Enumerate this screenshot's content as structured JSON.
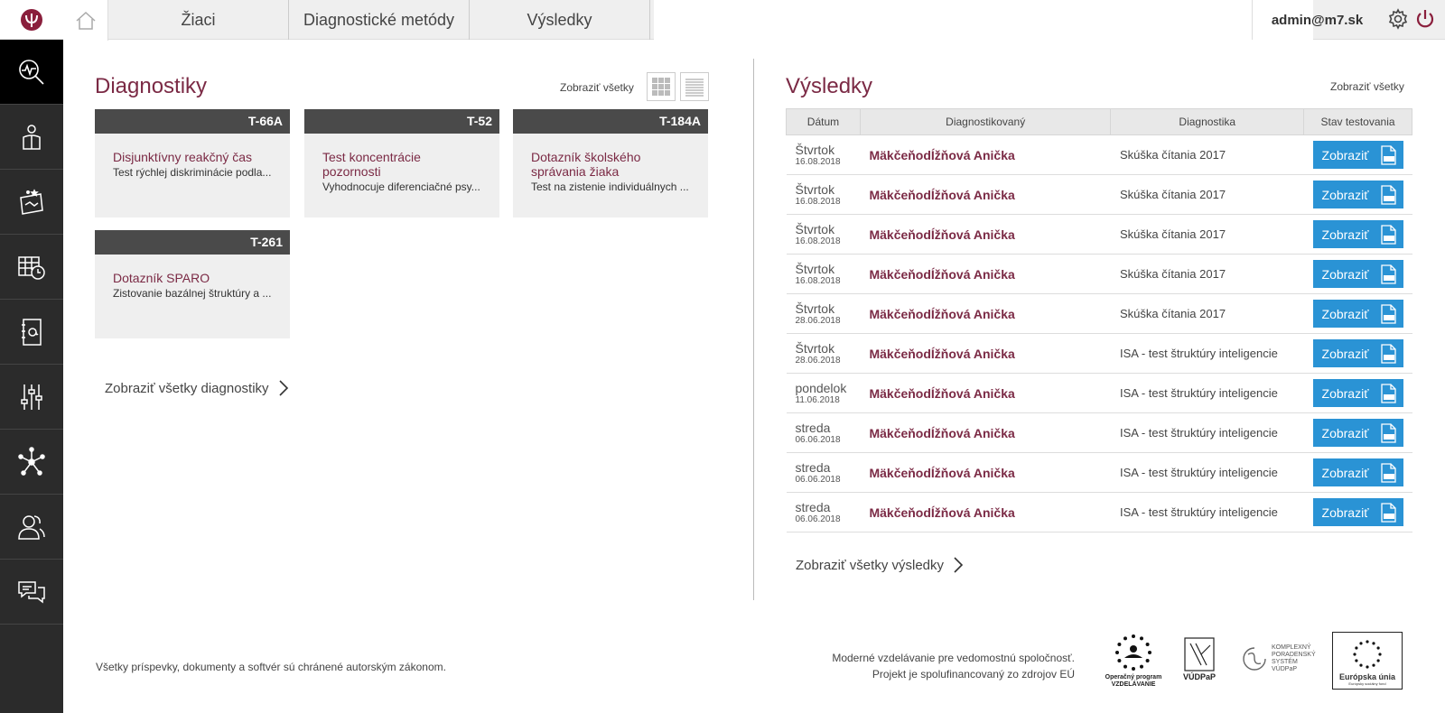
{
  "nav": {
    "tabs": [
      {
        "label": "Žiaci"
      },
      {
        "label": "Diagnostické metódy"
      },
      {
        "label": "Výsledky"
      }
    ],
    "user_email": "admin@m7.sk"
  },
  "sidebar": {
    "items": [
      {
        "icon": "diagnostics-icon",
        "active": true
      },
      {
        "icon": "student-reading-icon"
      },
      {
        "icon": "book-stars-icon"
      },
      {
        "icon": "calendar-clock-icon"
      },
      {
        "icon": "address-book-icon"
      },
      {
        "icon": "sliders-icon"
      },
      {
        "icon": "network-icon"
      },
      {
        "icon": "users-icon"
      },
      {
        "icon": "chat-icon"
      }
    ]
  },
  "diagnostics": {
    "title": "Diagnostiky",
    "show_all": "Zobraziť všetky",
    "cards": [
      {
        "code": "T-66A",
        "title": "Disjunktívny reakčný čas",
        "desc": "Test rýchlej diskriminácie podla..."
      },
      {
        "code": "T-52",
        "title": "Test koncentrácie pozornosti",
        "desc": "Vyhodnocuje diferenciačné psy..."
      },
      {
        "code": "T-184A",
        "title": "Dotazník školského správania žiaka",
        "desc": "Test na zistenie individuálnych ..."
      },
      {
        "code": "T-261",
        "title": "Dotazník SPARO",
        "desc": "Zistovanie bazálnej štruktúry a ..."
      }
    ],
    "more_link": "Zobraziť všetky diagnostiky"
  },
  "results": {
    "title": "Výsledky",
    "show_all": "Zobraziť všetky",
    "columns": [
      "Dátum",
      "Diagnostikovaný",
      "Diagnostika",
      "Stav testovania"
    ],
    "button_label": "Zobraziť",
    "rows": [
      {
        "day": "Štvrtok",
        "date": "16.08.2018",
        "name": "MäkčeňodÍžňová Anička",
        "diag": "Skúška čítania 2017"
      },
      {
        "day": "Štvrtok",
        "date": "16.08.2018",
        "name": "MäkčeňodÍžňová Anička",
        "diag": "Skúška čítania 2017"
      },
      {
        "day": "Štvrtok",
        "date": "16.08.2018",
        "name": "MäkčeňodÍžňová Anička",
        "diag": "Skúška čítania 2017"
      },
      {
        "day": "Štvrtok",
        "date": "16.08.2018",
        "name": "MäkčeňodÍžňová Anička",
        "diag": "Skúška čítania 2017"
      },
      {
        "day": "Štvrtok",
        "date": "28.06.2018",
        "name": "MäkčeňodÍžňová Anička",
        "diag": "Skúška čítania 2017"
      },
      {
        "day": "Štvrtok",
        "date": "28.06.2018",
        "name": "MäkčeňodÍžňová Anička",
        "diag": "ISA - test štruktúry inteligencie"
      },
      {
        "day": "pondelok",
        "date": "11.06.2018",
        "name": "MäkčeňodÍžňová Anička",
        "diag": "ISA - test štruktúry inteligencie"
      },
      {
        "day": "streda",
        "date": "06.06.2018",
        "name": "MäkčeňodÍžňová Anička",
        "diag": "ISA - test štruktúry inteligencie"
      },
      {
        "day": "streda",
        "date": "06.06.2018",
        "name": "MäkčeňodÍžňová Anička",
        "diag": "ISA - test štruktúry inteligencie"
      },
      {
        "day": "streda",
        "date": "06.06.2018",
        "name": "MäkčeňodÍžňová Anička",
        "diag": "ISA - test štruktúry inteligencie"
      }
    ],
    "more_link": "Zobraziť všetky výsledky"
  },
  "footer": {
    "copyright": "Všetky príspevky, dokumenty a softvér sú chránené autorským zákonom.",
    "line1": "Moderné vzdelávanie pre vedomostnú spoločnosť.",
    "line2": "Projekt je spolufinancovaný zo zdrojov EÚ",
    "logo_op": "Operačný program VZDELÁVANIE",
    "logo_vudpap": "VÚDPaP",
    "logo_kps": "KOMPLEXNÝ PORADENSKÝ SYSTÉM VÚDPaP",
    "logo_eu": "Európska únia",
    "logo_eu_sub": "Európsky sociálny fond"
  },
  "colors": {
    "accent": "#7b2a45",
    "button_blue": "#2a93d5",
    "sidebar_bg": "#2b2b2b",
    "card_head": "#4a4a4a"
  }
}
